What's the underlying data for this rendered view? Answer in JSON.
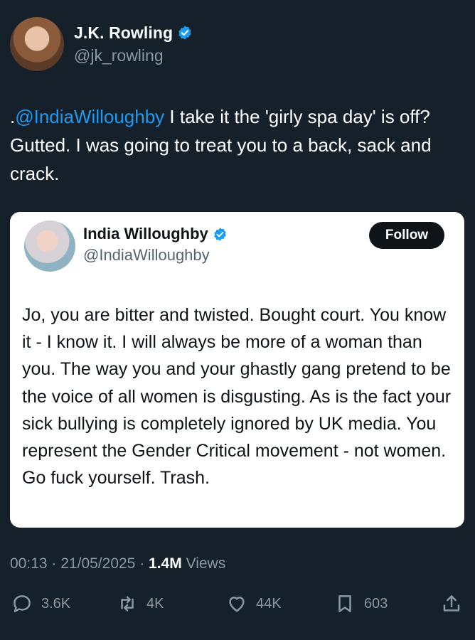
{
  "author": {
    "display_name": "J.K. Rowling",
    "handle": "@jk_rowling"
  },
  "tweet": {
    "prefix": ".",
    "mention": "@IndiaWilloughby",
    "text": " I take it the 'girly spa day' is off? Gutted. I was going to treat you to a back, sack and crack."
  },
  "quoted": {
    "display_name": "India Willoughby",
    "handle": "@IndiaWilloughby",
    "follow_label": "Follow",
    "text": "Jo, you are bitter and twisted. Bought court. You know it - I know it. I will always be more of a woman than you. The way you and your ghastly gang pretend to be the voice of all women is disgusting. As is the fact your sick bullying is completely ignored by UK media. You represent the Gender Critical movement - not women.  Go fuck yourself. Trash."
  },
  "meta": {
    "time": "00:13",
    "date": "21/05/2025",
    "separator": "·",
    "views_count": "1.4M",
    "views_label": "Views"
  },
  "actions": {
    "replies": "3.6K",
    "reposts": "4K",
    "likes": "44K",
    "bookmarks": "603"
  },
  "colors": {
    "background": "#15202b",
    "accent": "#1d9bf0",
    "muted": "#8b98a5"
  }
}
